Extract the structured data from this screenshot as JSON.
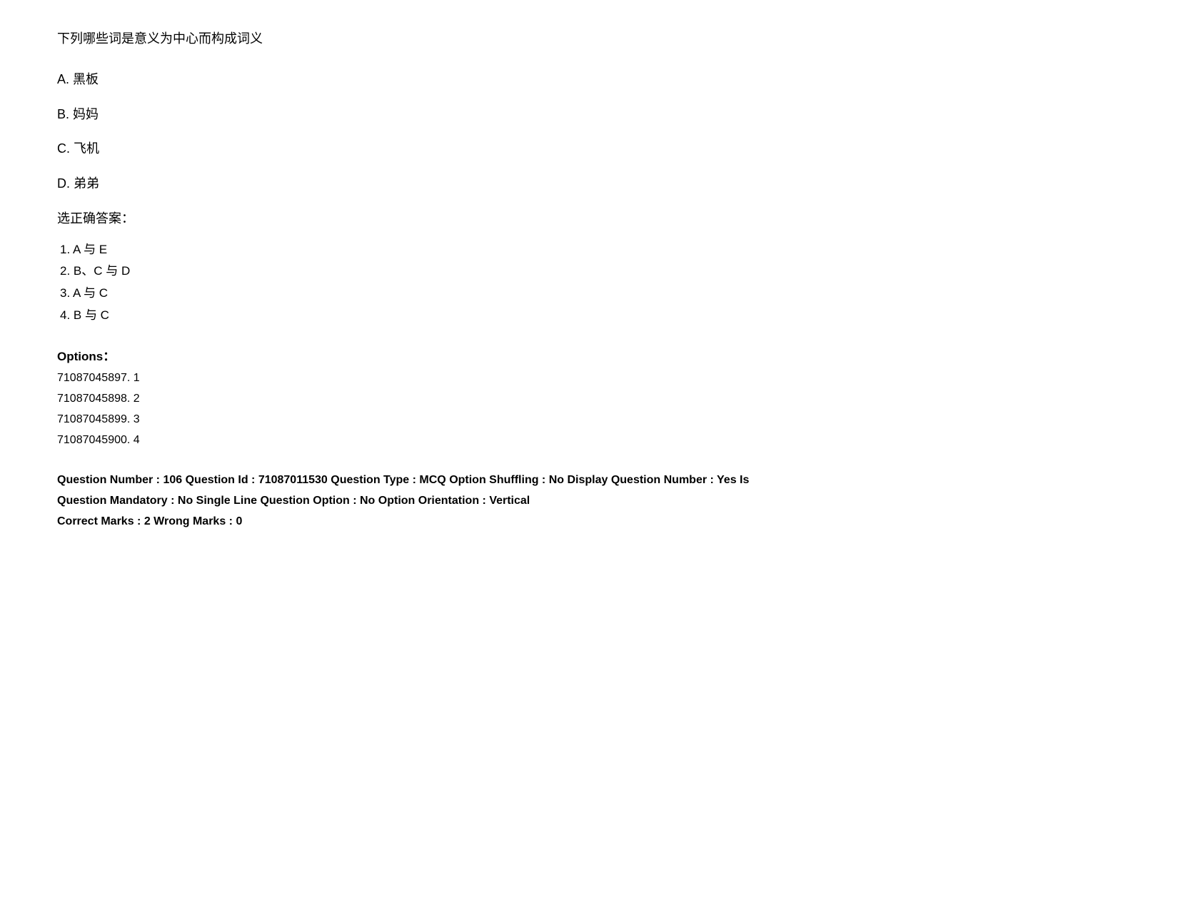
{
  "question": {
    "text": "下列哪些词是意义为中心而构成词义",
    "options": [
      {
        "label": "A. 黑板"
      },
      {
        "label": "B. 妈妈"
      },
      {
        "label": "C. 飞机"
      },
      {
        "label": "D. 弟弟"
      }
    ],
    "correct_answer_label": "选正确答案：",
    "answers": [
      "1. A 与 E",
      "2. B、C 与 D",
      "3. A 与 C",
      "4. B 与 C"
    ]
  },
  "options_section": {
    "heading": "Options：",
    "items": [
      "71087045897. 1",
      "71087045898. 2",
      "71087045899. 3",
      "71087045900. 4"
    ]
  },
  "meta": {
    "line1": "Question Number : 106 Question Id : 71087011530 Question Type : MCQ Option Shuffling : No Display Question Number : Yes Is",
    "line2": "Question Mandatory : No Single Line Question Option : No Option Orientation : Vertical",
    "line3": "Correct Marks : 2 Wrong Marks : 0"
  }
}
